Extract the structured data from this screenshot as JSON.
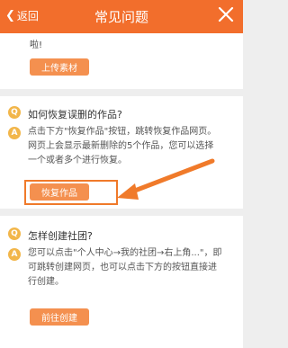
{
  "header": {
    "back_label": "返回",
    "title": "常见问题",
    "background": "#f26e2c"
  },
  "card1": {
    "tail_text": "啦!",
    "button_label": "上传素材"
  },
  "qa1": {
    "question": "如何恢复误删的作品?",
    "answer_lines": [
      "点击下方\"恢复作品\"按钮，跳转恢复作品网页。",
      "网页上会显示最新删除的5个作品，您可以选择",
      "一个或者多个进行恢复。"
    ],
    "button_label": "恢复作品"
  },
  "qa2": {
    "question": "怎样创建社团?",
    "answer_lines": [
      "您可以点击\"个人中心→我的社团→右上角...\"，即",
      "可跳转创建网页，也可以点击下方的按钮直接进",
      "行创建。"
    ],
    "button_label": "前往创建"
  },
  "badges": {
    "question": "Q",
    "answer": "A"
  },
  "colors": {
    "accent": "#f26e2c",
    "button": "#f4904f",
    "badge": "#f2b64a"
  },
  "icons": {
    "back": "chevron-left-icon",
    "close": "close-icon",
    "annotation": "arrow-icon"
  }
}
